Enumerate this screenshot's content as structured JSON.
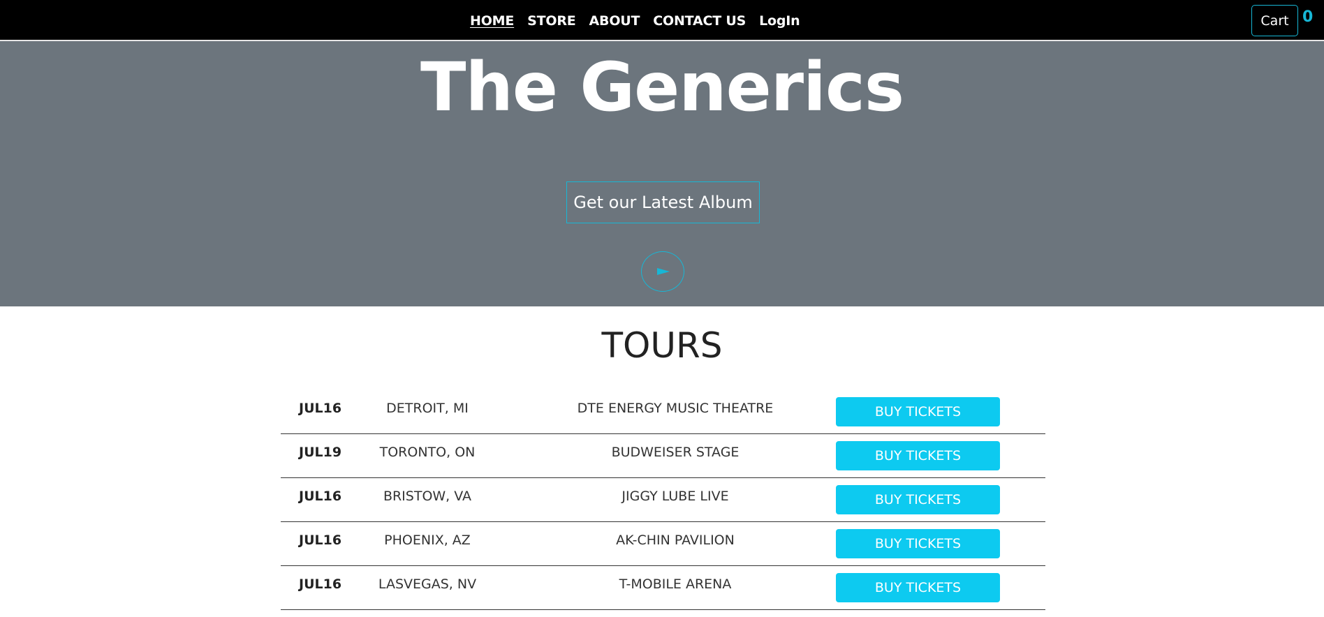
{
  "nav": {
    "links": [
      {
        "label": "HOME",
        "active": true
      },
      {
        "label": "STORE",
        "active": false
      },
      {
        "label": "ABOUT",
        "active": false
      },
      {
        "label": "CONTACT US",
        "active": false
      },
      {
        "label": "LogIn",
        "active": false
      }
    ],
    "cart_label": "Cart",
    "cart_count": "0"
  },
  "hero": {
    "title": "The Generics",
    "album_button_label": "Get our Latest Album",
    "play_icon": "play-icon"
  },
  "tours": {
    "heading": "TOURS",
    "rows": [
      {
        "date": "JUL16",
        "city": "DETROIT, MI",
        "venue": "DTE ENERGY MUSIC THEATRE",
        "button": "BUY TICKETS"
      },
      {
        "date": "JUL19",
        "city": "TORONTO, ON",
        "venue": "BUDWEISER STAGE",
        "button": "BUY TICKETS"
      },
      {
        "date": "JUL16",
        "city": "BRISTOW, VA",
        "venue": "JIGGY LUBE LIVE",
        "button": "BUY TICKETS"
      },
      {
        "date": "JUL16",
        "city": "PHOENIX, AZ",
        "venue": "AK-CHIN PAVILION",
        "button": "BUY TICKETS"
      },
      {
        "date": "JUL16",
        "city": "LASVEGAS, NV",
        "venue": "T-MOBILE ARENA",
        "button": "BUY TICKETS"
      }
    ]
  },
  "colors": {
    "navbar_bg": "#000000",
    "hero_bg": "#6c757d",
    "accent": "#17b7d6",
    "button_bg": "#0dcaf0"
  }
}
